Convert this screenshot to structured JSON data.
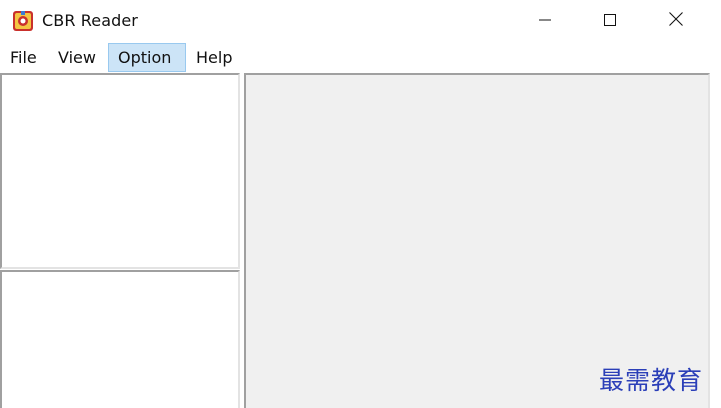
{
  "window": {
    "title": "CBR Reader",
    "icon": "cbr-reader-app-icon",
    "controls": {
      "minimize_icon": "minimize-icon",
      "maximize_icon": "maximize-icon",
      "close_icon": "close-icon"
    }
  },
  "menu": {
    "items": [
      {
        "label": "File"
      },
      {
        "label": "View"
      },
      {
        "label": "Option",
        "highlighted": true
      },
      {
        "label": "Help"
      }
    ]
  },
  "panes": {
    "top_left": "",
    "bottom_left": "",
    "viewer": ""
  },
  "watermark": {
    "text": "最需教育",
    "color": "#2b3fb8"
  },
  "colors": {
    "menu_highlight": "#cce4f7",
    "viewer_background": "#f0f0f0"
  }
}
